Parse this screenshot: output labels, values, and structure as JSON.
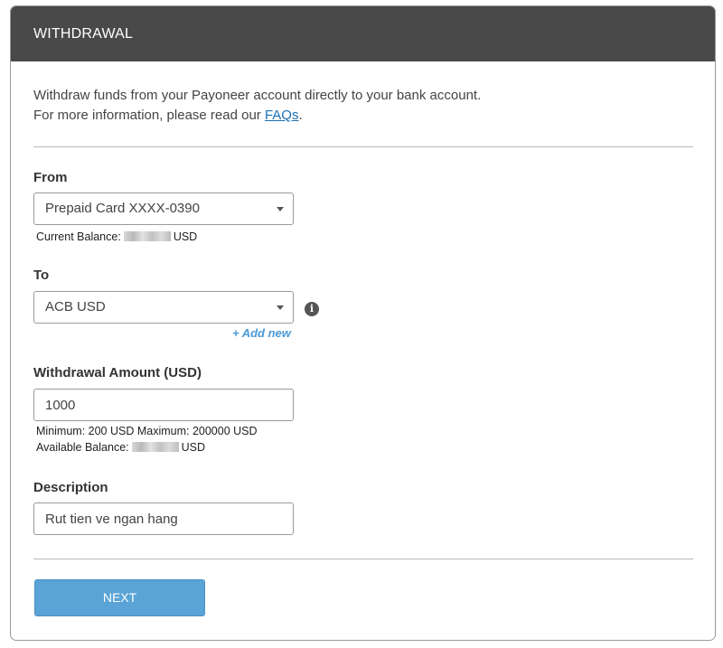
{
  "header": {
    "title": "WITHDRAWAL"
  },
  "intro": {
    "line1": "Withdraw funds from your Payoneer account directly to your bank account.",
    "line2_prefix": "For more information, please read our ",
    "faq_link": "FAQs",
    "line2_suffix": "."
  },
  "from": {
    "label": "From",
    "selected": "Prepaid Card XXXX-0390",
    "balance_prefix": "Current Balance:",
    "balance_currency": "USD"
  },
  "to": {
    "label": "To",
    "selected": "ACB USD",
    "add_new": "+ Add new"
  },
  "amount": {
    "label": "Withdrawal Amount (USD)",
    "value": "1000",
    "limits": "Minimum: 200 USD  Maximum: 200000 USD",
    "available_prefix": "Available Balance:",
    "available_currency": "USD"
  },
  "description": {
    "label": "Description",
    "value": "Rut tien ve ngan hang"
  },
  "actions": {
    "next_label": "NEXT"
  },
  "colors": {
    "header_bg": "#494949",
    "link": "#1a6fb3",
    "add_new": "#4a9ad8",
    "button": "#5aa3d6"
  },
  "icons": {
    "info": "info-circle-icon",
    "dropdown": "caret-down-icon"
  }
}
